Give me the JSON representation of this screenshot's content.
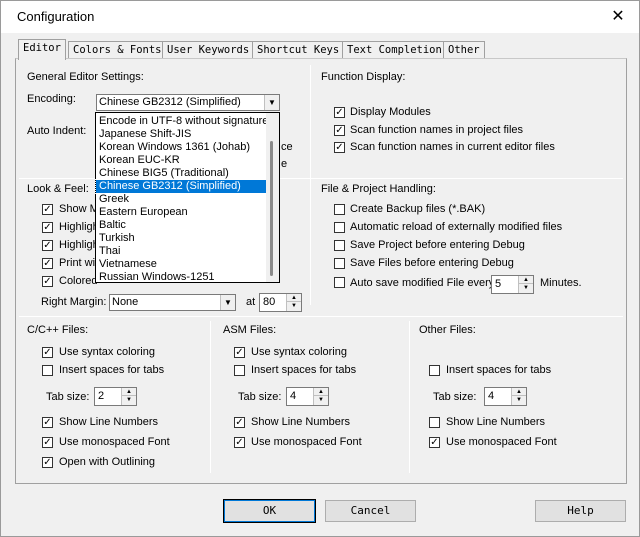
{
  "window": {
    "title": "Configuration",
    "close_glyph": "✕"
  },
  "tabs": [
    {
      "label": "Editor",
      "active": true
    },
    {
      "label": "Colors & Fonts"
    },
    {
      "label": "User Keywords"
    },
    {
      "label": "Shortcut Keys"
    },
    {
      "label": "Text Completion"
    },
    {
      "label": "Other"
    }
  ],
  "general": {
    "heading": "General Editor Settings:",
    "encoding_label": "Encoding:",
    "encoding_value": "Chinese GB2312 (Simplified)",
    "auto_indent_label": "Auto Indent:",
    "hidden_text_1": "ce",
    "hidden_text_2": "e"
  },
  "encoding_options": [
    "Encode in UTF-8 without signature",
    "Japanese Shift-JIS",
    "Korean Windows 1361 (Johab)",
    "Korean EUC-KR",
    "Chinese BIG5 (Traditional)",
    "Chinese GB2312 (Simplified)",
    "Greek",
    "Eastern European",
    "Baltic",
    "Turkish",
    "Thai",
    "Vietnamese",
    "Russian Windows-1251"
  ],
  "function_display": {
    "heading": "Function Display:",
    "items": [
      {
        "label": "Display Modules",
        "checked": true
      },
      {
        "label": "Scan function names in project files",
        "checked": true
      },
      {
        "label": "Scan function names in current editor files",
        "checked": true
      }
    ]
  },
  "look_feel": {
    "heading": "Look & Feel:",
    "items": [
      {
        "label": "Show M",
        "checked": true
      },
      {
        "label": "Highligh",
        "checked": true
      },
      {
        "label": "Highligh",
        "checked": true
      },
      {
        "label": "Print wit",
        "checked": true
      },
      {
        "label": "Colored",
        "checked": true
      }
    ],
    "right_margin_label": "Right Margin:",
    "right_margin_value": "None",
    "at_label": "at",
    "at_value": "80"
  },
  "file_project": {
    "heading": "File & Project Handling:",
    "items": [
      {
        "label": "Create Backup files (*.BAK)",
        "checked": false
      },
      {
        "label": "Automatic reload of externally modified files",
        "checked": false
      },
      {
        "label": "Save Project before entering Debug",
        "checked": false
      },
      {
        "label": "Save Files before entering Debug",
        "checked": false
      },
      {
        "label": "Auto save modified File every",
        "checked": false
      }
    ],
    "autosave_value": "5",
    "minutes_label": "Minutes."
  },
  "cpp_files": {
    "heading": "C/C++ Files:",
    "use_syntax": "Use syntax coloring",
    "insert_spaces": "Insert spaces for tabs",
    "tab_size_label": "Tab size:",
    "tab_size": "2",
    "show_line": "Show Line Numbers",
    "monospaced": "Use monospaced Font",
    "outlining": "Open with Outlining"
  },
  "asm_files": {
    "heading": "ASM Files:",
    "use_syntax": "Use syntax coloring",
    "insert_spaces": "Insert spaces for tabs",
    "tab_size_label": "Tab size:",
    "tab_size": "4",
    "show_line": "Show Line Numbers",
    "monospaced": "Use monospaced Font"
  },
  "other_files": {
    "heading": "Other Files:",
    "insert_spaces": "Insert spaces for tabs",
    "tab_size_label": "Tab size:",
    "tab_size": "4",
    "show_line": "Show Line Numbers",
    "monospaced": "Use monospaced Font"
  },
  "buttons": {
    "ok": "OK",
    "cancel": "Cancel",
    "help": "Help"
  },
  "glyphs": {
    "check": "✓",
    "arrow_down": "▼",
    "arrow_up": "▲"
  }
}
